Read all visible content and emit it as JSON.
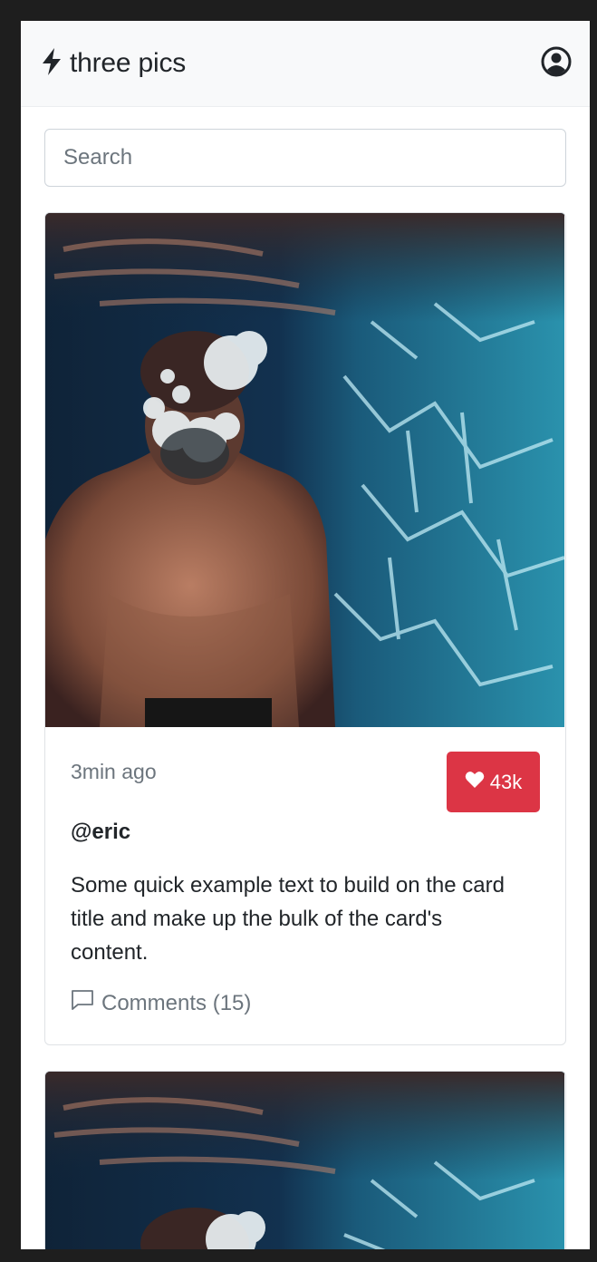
{
  "app": {
    "brand_name": "three pics",
    "brand_icon": "lightning-bolt-icon",
    "profile_icon": "person-circle-icon"
  },
  "search": {
    "placeholder": "Search",
    "value": ""
  },
  "posts": [
    {
      "timestamp": "3min ago",
      "likes": "43k",
      "like_icon": "heart-icon",
      "username": "@eric",
      "text": "Some quick example text to build on the card title and make up the bulk of the card's content.",
      "comments_label": "Comments (15)",
      "comment_icon": "chat-bubble-icon"
    }
  ],
  "colors": {
    "like_button": "#dc3545",
    "navbar_bg": "#f8f9fa",
    "muted_text": "#6c757d"
  }
}
